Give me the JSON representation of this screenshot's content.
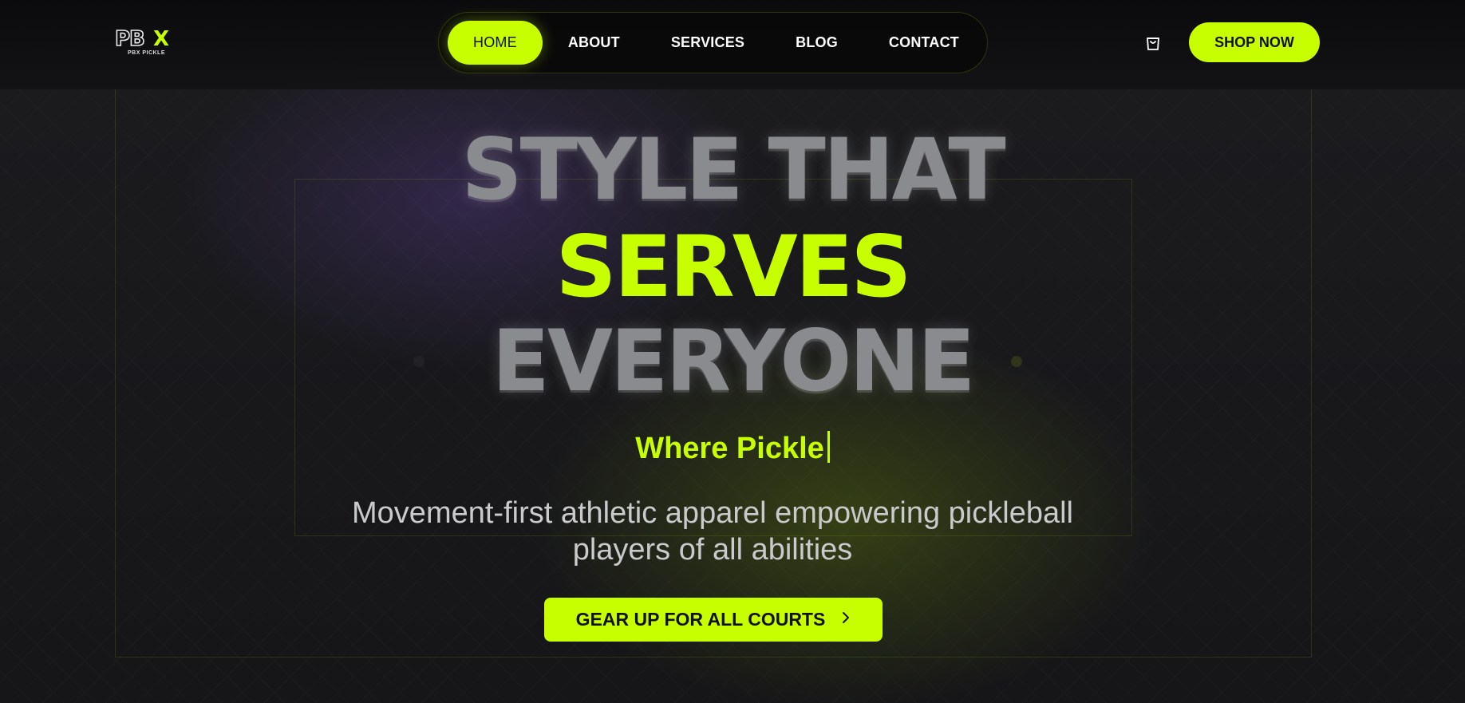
{
  "brand": {
    "logo_text": "PB",
    "logo_x": "X",
    "logo_sub": "PBX PICKLE",
    "accent_color": "#c8ff00"
  },
  "nav": {
    "items": [
      {
        "label": "HOME",
        "active": true
      },
      {
        "label": "ABOUT",
        "active": false
      },
      {
        "label": "SERVICES",
        "active": false
      },
      {
        "label": "BLOG",
        "active": false
      },
      {
        "label": "CONTACT",
        "active": false
      }
    ]
  },
  "header": {
    "cart_icon": "shopping-bag-icon",
    "shop_label": "SHOP NOW"
  },
  "hero": {
    "line1": "STYLE THAT",
    "line2": "SERVES",
    "line3": "EVERYONE",
    "tagline": "Where Pickle",
    "subtitle": "Movement-first athletic apparel empowering pickleball players of all abilities",
    "cta_label": "GEAR UP FOR ALL COURTS",
    "cta_icon": "chevron-right-icon"
  }
}
